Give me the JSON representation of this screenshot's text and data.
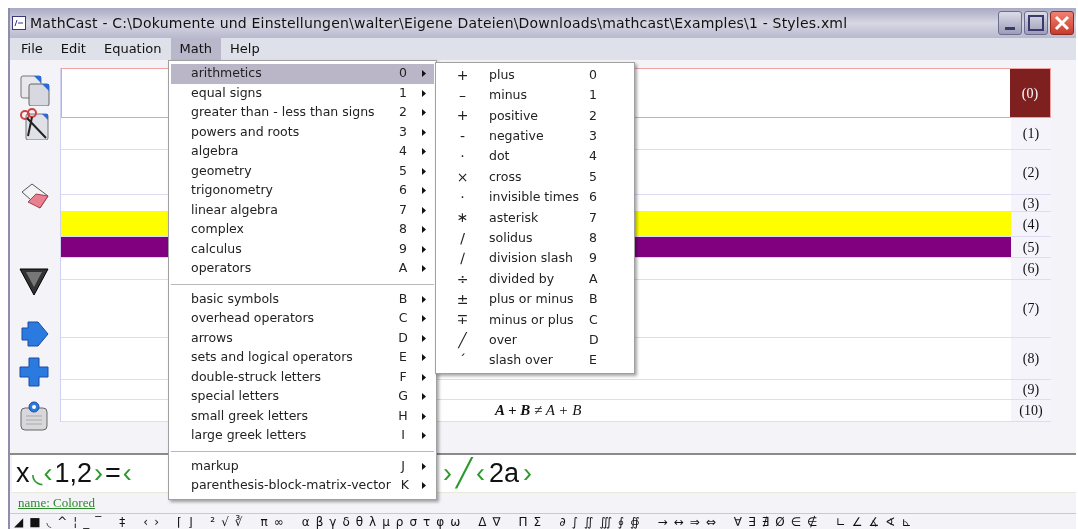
{
  "window": {
    "title": "MathCast - C:\\Dokumente und Einstellungen\\walter\\Eigene Dateien\\Downloads\\mathcast\\Examples\\1 - Styles.xml"
  },
  "menu_bar": [
    {
      "label": "File",
      "selected": false
    },
    {
      "label": "Edit",
      "selected": false
    },
    {
      "label": "Equation",
      "selected": false
    },
    {
      "label": "Math",
      "selected": true
    },
    {
      "label": "Help",
      "selected": false
    }
  ],
  "equations": [
    {
      "number": "(0)",
      "selected": true
    },
    {
      "number": "(1)",
      "selected": false
    },
    {
      "number": "(2)",
      "selected": false
    },
    {
      "number": "(3)",
      "selected": false
    },
    {
      "number": "(4)",
      "selected": false,
      "color": "#ffff00"
    },
    {
      "number": "(5)",
      "selected": false,
      "color": "#800080"
    },
    {
      "number": "(6)",
      "selected": false
    },
    {
      "number": "(7)",
      "selected": false
    },
    {
      "number": "(8)",
      "selected": false
    },
    {
      "number": "(9)",
      "selected": false
    },
    {
      "number": "(10)",
      "selected": false,
      "formula": "**A + B** ≠ A + B"
    }
  ],
  "math_menu": [
    [
      {
        "label": "arithmetics",
        "key": "0",
        "selected": true
      },
      {
        "label": "equal signs",
        "key": "1",
        "selected": false
      },
      {
        "label": "greater than - less than signs",
        "key": "2",
        "selected": false
      },
      {
        "label": "powers and roots",
        "key": "3",
        "selected": false
      },
      {
        "label": "algebra",
        "key": "4",
        "selected": false
      },
      {
        "label": "geometry",
        "key": "5",
        "selected": false
      },
      {
        "label": "trigonometry",
        "key": "6",
        "selected": false
      },
      {
        "label": "linear algebra",
        "key": "7",
        "selected": false
      },
      {
        "label": "complex",
        "key": "8",
        "selected": false
      },
      {
        "label": "calculus",
        "key": "9",
        "selected": false
      },
      {
        "label": "operators",
        "key": "A",
        "selected": false
      }
    ],
    [
      {
        "label": "basic symbols",
        "key": "B",
        "selected": false
      },
      {
        "label": "overhead operators",
        "key": "C",
        "selected": false
      },
      {
        "label": "arrows",
        "key": "D",
        "selected": false
      },
      {
        "label": "sets and logical operators",
        "key": "E",
        "selected": false
      },
      {
        "label": "double-struck letters",
        "key": "F",
        "selected": false
      },
      {
        "label": "special letters",
        "key": "G",
        "selected": false
      },
      {
        "label": "small greek letters",
        "key": "H",
        "selected": false
      },
      {
        "label": "large greek letters",
        "key": "I",
        "selected": false
      }
    ],
    [
      {
        "label": "markup",
        "key": "J",
        "selected": false
      },
      {
        "label": "parenthesis-block-matrix-vector",
        "key": "K",
        "selected": false
      }
    ]
  ],
  "submenu": [
    {
      "symbol": "+",
      "label": "plus",
      "key": "0"
    },
    {
      "symbol": "–",
      "label": "minus",
      "key": "1"
    },
    {
      "symbol": "+",
      "label": "positive",
      "key": "2"
    },
    {
      "symbol": "-",
      "label": "negative",
      "key": "3"
    },
    {
      "symbol": "·",
      "label": "dot",
      "key": "4"
    },
    {
      "symbol": "×",
      "label": "cross",
      "key": "5"
    },
    {
      "symbol": "·",
      "label": "invisible times",
      "key": "6"
    },
    {
      "symbol": "∗",
      "label": "asterisk",
      "key": "7"
    },
    {
      "symbol": "/",
      "label": "solidus",
      "key": "8"
    },
    {
      "symbol": "∕",
      "label": "division slash",
      "key": "9"
    },
    {
      "symbol": "÷",
      "label": "divided by",
      "key": "A"
    },
    {
      "symbol": "±",
      "label": "plus or minus",
      "key": "B"
    },
    {
      "symbol": "∓",
      "label": "minus or plus",
      "key": "C"
    },
    {
      "symbol": "╱",
      "label": "over",
      "key": "D"
    },
    {
      "symbol": "ˊ",
      "label": "slash over",
      "key": "E"
    }
  ],
  "editor": {
    "left": [
      {
        "text": "x",
        "kind": "plain"
      },
      {
        "text": "◟",
        "kind": "marker"
      },
      {
        "text": "‹",
        "kind": "marker"
      },
      {
        "text": "1,2",
        "kind": "plain"
      },
      {
        "text": "›",
        "kind": "marker"
      },
      {
        "text": "=",
        "kind": "plain"
      },
      {
        "text": "‹",
        "kind": "marker"
      }
    ],
    "right": [
      {
        "text": "›",
        "kind": "marker"
      },
      {
        "text": "╱",
        "kind": "marker"
      },
      {
        "text": "‹",
        "kind": "marker"
      },
      {
        "text": "2a",
        "kind": "plain"
      },
      {
        "text": "›",
        "kind": "marker"
      }
    ]
  },
  "style_link": "name: Colored",
  "palette": [
    [
      "◢",
      "■",
      "◟",
      "^",
      "¦",
      "_",
      "‾"
    ],
    [
      "‡"
    ],
    [
      "‹",
      "›"
    ],
    [
      "⌈",
      "⌋"
    ],
    [
      "²",
      "√",
      "∛"
    ],
    [
      "π",
      "∞"
    ],
    [
      "α",
      "β",
      "γ",
      "δ",
      "θ",
      "λ",
      "μ",
      "ρ",
      "σ",
      "τ",
      "φ",
      "ω"
    ],
    [
      "Δ",
      "∇"
    ],
    [
      "Π",
      "Σ"
    ],
    [
      "∂",
      "∫",
      "∬",
      "∭",
      "∮",
      "∯"
    ],
    [
      "→",
      "↔",
      "⇒",
      "⇔"
    ],
    [
      "∀",
      "∃",
      "∄",
      "Ø",
      "∈",
      "∉"
    ],
    [
      "∟",
      "∠",
      "∡",
      "∢",
      "⊾"
    ]
  ]
}
